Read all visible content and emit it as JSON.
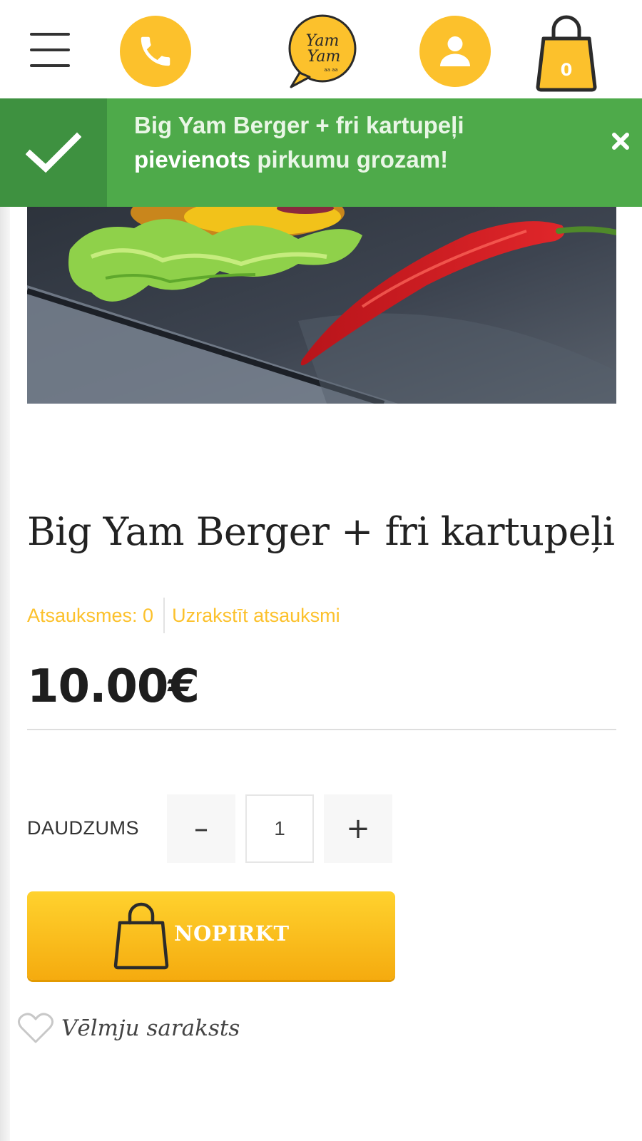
{
  "header": {
    "menu_icon": "hamburger-menu-icon",
    "phone_icon": "phone-icon",
    "logo_alt": "Yam Yam",
    "account_icon": "user-icon",
    "cart_icon": "shopping-bag-icon",
    "cart_count": "0",
    "accent_color": "#fcc12c"
  },
  "notification": {
    "line1": "Big Yam Berger + fri kartupeļi",
    "strong": "pievienots",
    "rest": "pirkumu grozam!",
    "icon": "check-icon",
    "close_icon": "close-icon",
    "color": "#4eaa4a"
  },
  "product": {
    "title": "Big Yam Berger + fri kartupeļi",
    "reviews_label": "Atsauksmes: 0",
    "write_review": "Uzrakstīt atsauksmi",
    "price": "10.00€"
  },
  "quantity": {
    "label": "DAUDZUMS",
    "minus": "–",
    "plus": "+",
    "value": "1"
  },
  "buy": {
    "label": "NOPIRKT",
    "icon": "shopping-bag-icon"
  },
  "wishlist": {
    "label": "Vēlmju saraksts",
    "icon": "heart-icon"
  }
}
